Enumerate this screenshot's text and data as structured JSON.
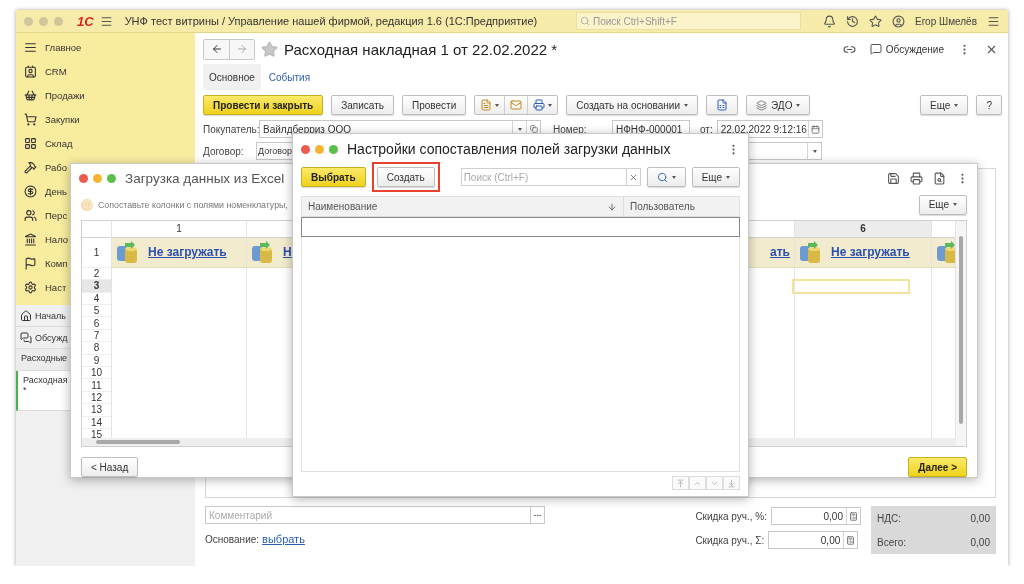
{
  "app": {
    "logo": "1С",
    "title": "УНФ тест витрины / Управление нашей фирмой, редакция 1.6  (1С:Предприятие)",
    "search": {
      "placeholder": "Поиск Ctrl+Shift+F"
    },
    "user": "Егор Шмелёв"
  },
  "sidebar": {
    "sections": [
      {
        "label": "Главное"
      },
      {
        "label": "CRM"
      },
      {
        "label": "Продажи"
      },
      {
        "label": "Закупки"
      },
      {
        "label": "Склад"
      },
      {
        "label": "Рабо"
      },
      {
        "label": "День"
      },
      {
        "label": "Перс"
      },
      {
        "label": "Нало"
      },
      {
        "label": "Комп"
      },
      {
        "label": "Наст"
      }
    ],
    "nav": [
      {
        "label": "Началь"
      },
      {
        "label": "Обсужд"
      }
    ],
    "open_windows": [
      {
        "label": "Расходные",
        "selected": false
      },
      {
        "label": "Расходная *",
        "selected": true
      }
    ]
  },
  "document": {
    "title": "Расходная накладная 1 от 22.02.2022 *",
    "discussion": "Обсуждение",
    "tabs": [
      {
        "label": "Основное",
        "selected": true
      },
      {
        "label": "События",
        "selected": false
      }
    ],
    "toolbar": {
      "post_close": "Провести и закрыть",
      "save": "Записать",
      "post": "Провести",
      "create_based": "Создать на основании",
      "edo": "ЭДО",
      "more": "Еще",
      "help": "?"
    },
    "fields": {
      "buyer_label": "Покупатель:",
      "buyer": "Вайлдберриз ООО",
      "number_label": "Номер:",
      "number": "НФНФ-000001",
      "date_label": "от:",
      "date": "22.02.2022  9:12:16",
      "contract_label": "Договор:",
      "contract": "Договор"
    },
    "footer": {
      "comment_placeholder": "Комментарий",
      "basis_label": "Основание:",
      "basis_link": "выбрать",
      "discount_pct_label": "Скидка руч., %:",
      "discount_pct": "0,00",
      "discount_sum_label": "Скидка руч., Σ:",
      "discount_sum": "0,00",
      "vat_label": "НДС:",
      "vat": "0,00",
      "total_label": "Всего:",
      "total": "0,00"
    }
  },
  "excel": {
    "title": "Загрузка данных из Excel",
    "hint": "Сопоставьте колонки с полями номенклатуры,",
    "more": "Еще",
    "grid": {
      "left_columns": [
        {
          "kind": "full",
          "header": "1",
          "link": "Не загружать",
          "selected": false
        },
        {
          "kind": "full",
          "link": "Н",
          "selected": false
        }
      ],
      "right_columns": [
        {
          "kind": "tail",
          "link": "ать",
          "selected": false
        },
        {
          "kind": "full",
          "header": "6",
          "link": "Не загружать",
          "selected": true
        },
        {
          "kind": "icon",
          "selected": false
        }
      ],
      "header_row": "1",
      "rows": [
        {
          "label": "2",
          "selected": false
        },
        {
          "label": "3",
          "selected": true
        },
        {
          "label": "4",
          "selected": false
        },
        {
          "label": "5",
          "selected": false
        },
        {
          "label": "6",
          "selected": false
        },
        {
          "label": "7",
          "selected": false
        },
        {
          "label": "8",
          "selected": false
        },
        {
          "label": "9",
          "selected": false
        },
        {
          "label": "10",
          "selected": false
        },
        {
          "label": "11",
          "selected": false
        },
        {
          "label": "12",
          "selected": false
        },
        {
          "label": "13",
          "selected": false
        },
        {
          "label": "14",
          "selected": false
        },
        {
          "label": "15",
          "selected": false
        }
      ]
    },
    "back": "< Назад",
    "next": "Далее >"
  },
  "settings": {
    "title": "Настройки сопоставления полей загрузки данных",
    "select": "Выбрать",
    "create": {
      "label": "Создать",
      "highlighted": true
    },
    "search": {
      "placeholder": "Поиск (Ctrl+F)"
    },
    "more": "Еще",
    "columns": [
      {
        "label": "Наименование",
        "sorted": true
      },
      {
        "label": "Пользователь",
        "sorted": false
      }
    ]
  }
}
